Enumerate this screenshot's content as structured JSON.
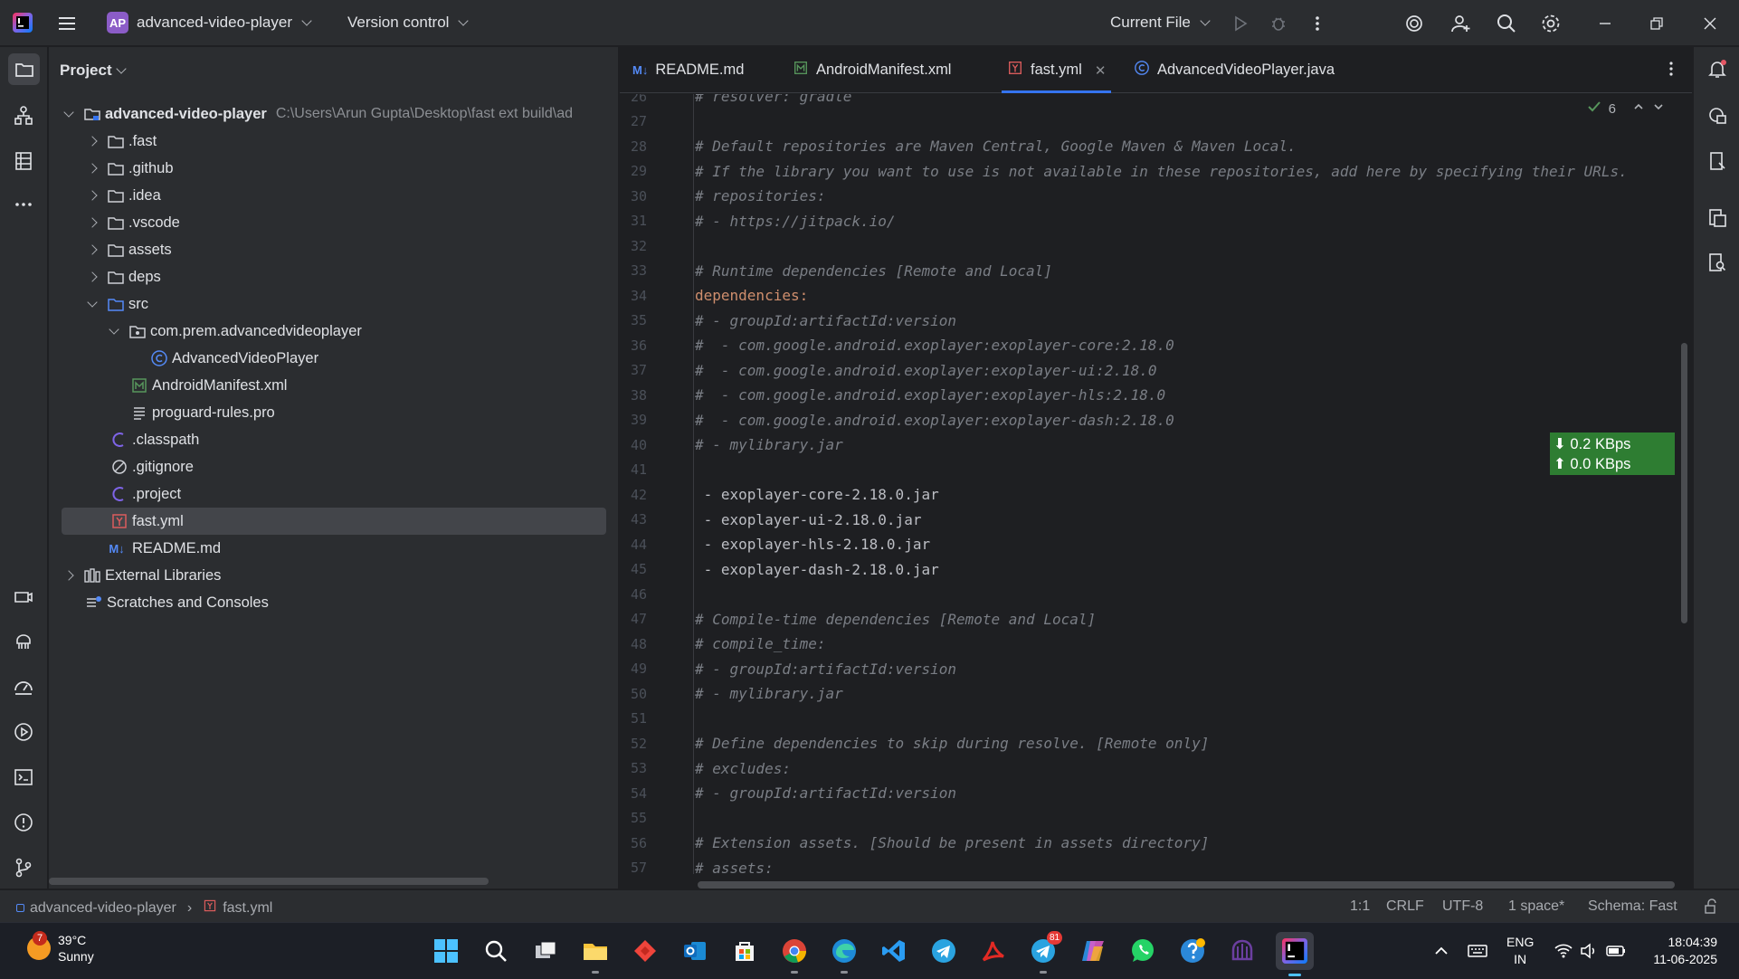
{
  "titlebar": {
    "project_badge": "AP",
    "project_name": "advanced-video-player",
    "vcs_menu": "Version control",
    "run_config": "Current File"
  },
  "project_panel": {
    "header": "Project",
    "root": {
      "name": "advanced-video-player",
      "path": "C:\\Users\\Arun Gupta\\Desktop\\fast ext build\\ad"
    },
    "folders": [
      ".fast",
      ".github",
      ".idea",
      ".vscode",
      "assets",
      "deps",
      "src"
    ],
    "package": "com.prem.advancedvideoplayer",
    "class_file": "AdvancedVideoPlayer",
    "manifest": "AndroidManifest.xml",
    "proguard": "proguard-rules.pro",
    "files": [
      ".classpath",
      ".gitignore",
      ".project",
      "fast.yml",
      "README.md"
    ],
    "external_libraries": "External Libraries",
    "scratches": "Scratches and Consoles"
  },
  "tabs": [
    {
      "label": "README.md",
      "icon": "M↓"
    },
    {
      "label": "AndroidManifest.xml",
      "icon": "M"
    },
    {
      "label": "fast.yml",
      "icon": "Y"
    },
    {
      "label": "AdvancedVideoPlayer.java",
      "icon": "C"
    }
  ],
  "inspection": {
    "count": "6"
  },
  "code_lines": [
    {
      "n": "26",
      "t": "# resolver: gradle",
      "k": "cmt"
    },
    {
      "n": "27",
      "t": "",
      "k": "plain"
    },
    {
      "n": "28",
      "t": "# Default repositories are Maven Central, Google Maven & Maven Local.",
      "k": "cmt"
    },
    {
      "n": "29",
      "t": "# If the library you want to use is not available in these repositories, add here by specifying their URLs.",
      "k": "cmt"
    },
    {
      "n": "30",
      "t": "# repositories:",
      "k": "cmt"
    },
    {
      "n": "31",
      "t": "# - https://jitpack.io/",
      "k": "cmt"
    },
    {
      "n": "32",
      "t": "",
      "k": "plain"
    },
    {
      "n": "33",
      "t": "# Runtime dependencies [Remote and Local]",
      "k": "cmt"
    },
    {
      "n": "34",
      "t": "dependencies:",
      "k": "key"
    },
    {
      "n": "35",
      "t": "# - groupId:artifactId:version",
      "k": "cmt"
    },
    {
      "n": "36",
      "t": "#  - com.google.android.exoplayer:exoplayer-core:2.18.0",
      "k": "cmt"
    },
    {
      "n": "37",
      "t": "#  - com.google.android.exoplayer:exoplayer-ui:2.18.0",
      "k": "cmt"
    },
    {
      "n": "38",
      "t": "#  - com.google.android.exoplayer:exoplayer-hls:2.18.0",
      "k": "cmt"
    },
    {
      "n": "39",
      "t": "#  - com.google.android.exoplayer:exoplayer-dash:2.18.0",
      "k": "cmt"
    },
    {
      "n": "40",
      "t": "# - mylibrary.jar",
      "k": "cmt"
    },
    {
      "n": "41",
      "t": "",
      "k": "plain"
    },
    {
      "n": "42",
      "t": " - exoplayer-core-2.18.0.jar",
      "k": "plain"
    },
    {
      "n": "43",
      "t": " - exoplayer-ui-2.18.0.jar",
      "k": "plain"
    },
    {
      "n": "44",
      "t": " - exoplayer-hls-2.18.0.jar",
      "k": "plain"
    },
    {
      "n": "45",
      "t": " - exoplayer-dash-2.18.0.jar",
      "k": "plain"
    },
    {
      "n": "46",
      "t": "",
      "k": "plain"
    },
    {
      "n": "47",
      "t": "# Compile-time dependencies [Remote and Local]",
      "k": "cmt"
    },
    {
      "n": "48",
      "t": "# compile_time:",
      "k": "cmt"
    },
    {
      "n": "49",
      "t": "# - groupId:artifactId:version",
      "k": "cmt"
    },
    {
      "n": "50",
      "t": "# - mylibrary.jar",
      "k": "cmt"
    },
    {
      "n": "51",
      "t": "",
      "k": "plain"
    },
    {
      "n": "52",
      "t": "# Define dependencies to skip during resolve. [Remote only]",
      "k": "cmt"
    },
    {
      "n": "53",
      "t": "# excludes:",
      "k": "cmt"
    },
    {
      "n": "54",
      "t": "# - groupId:artifactId:version",
      "k": "cmt"
    },
    {
      "n": "55",
      "t": "",
      "k": "plain"
    },
    {
      "n": "56",
      "t": "# Extension assets. [Should be present in assets directory]",
      "k": "cmt"
    },
    {
      "n": "57",
      "t": "# assets:",
      "k": "cmt"
    }
  ],
  "network": {
    "down": "0.2 KBps",
    "up": "0.0 KBps"
  },
  "statusbar": {
    "crumb_project": "advanced-video-player",
    "crumb_file": "fast.yml",
    "position": "1:1",
    "line_sep": "CRLF",
    "encoding": "UTF-8",
    "indent": "1 space*",
    "schema": "Schema: Fast"
  },
  "taskbar": {
    "weather_temp": "39°C",
    "weather_desc": "Sunny",
    "weather_badge": "7",
    "telegram_badge": "81",
    "lang_top": "ENG",
    "lang_bottom": "IN",
    "time": "18:04:39",
    "date": "11-06-2025"
  }
}
